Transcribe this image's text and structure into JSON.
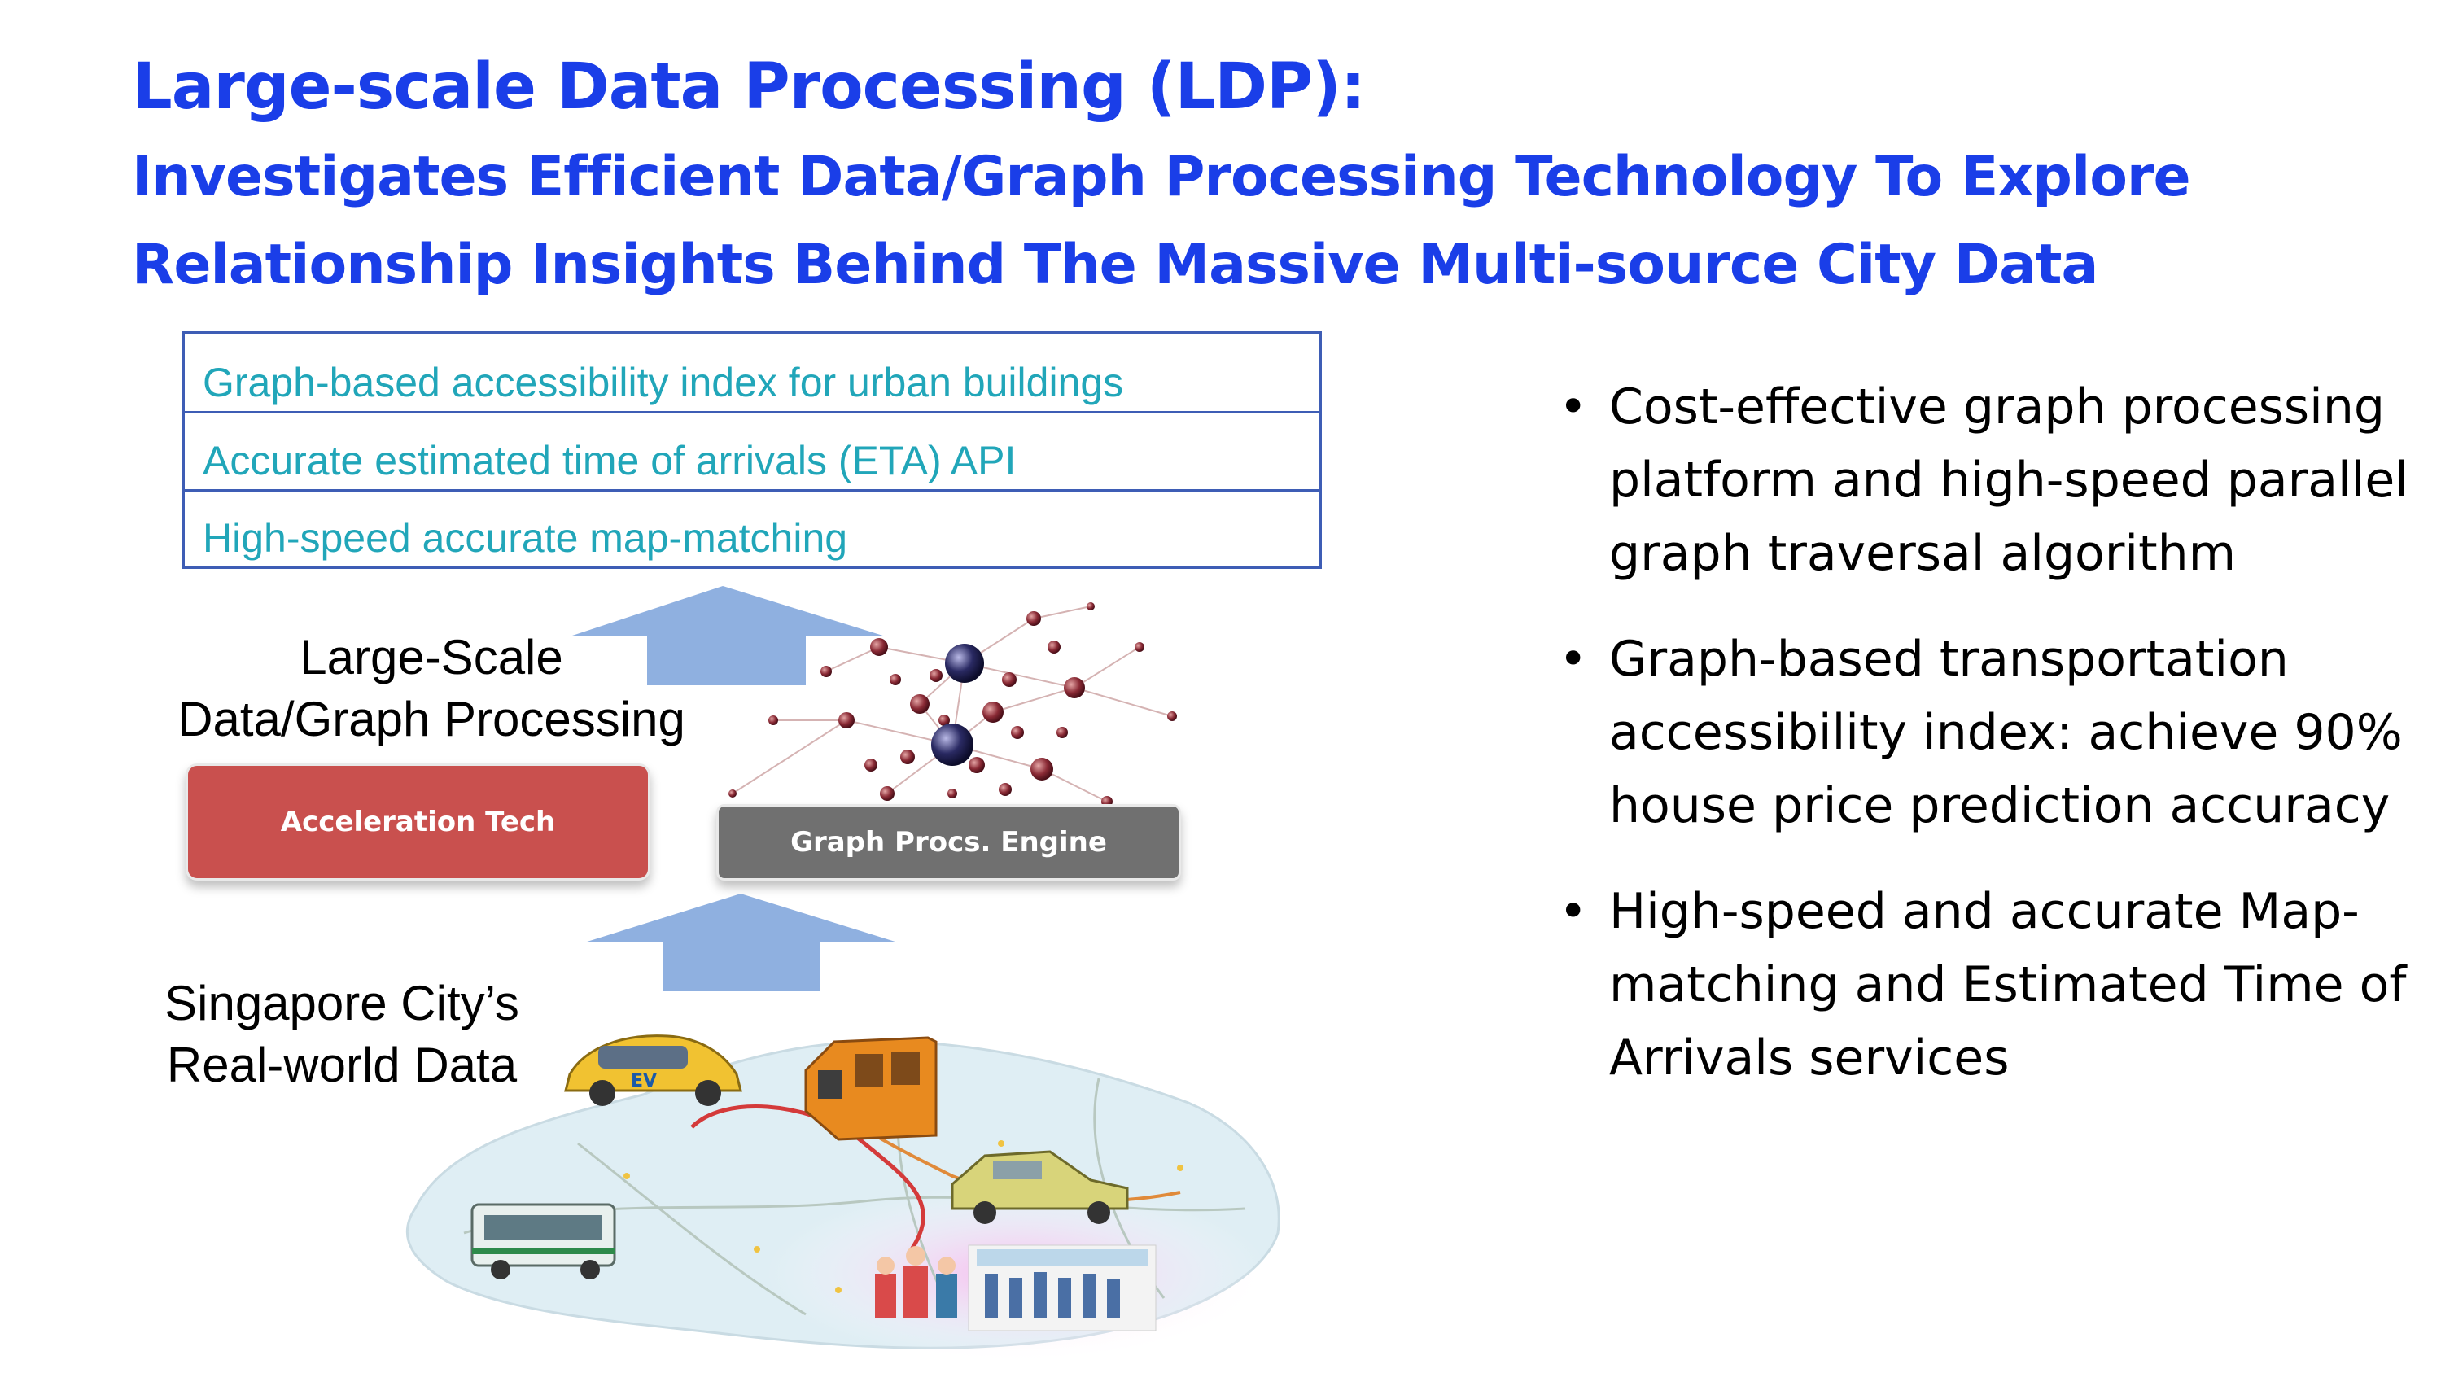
{
  "title": {
    "main": "Large-scale Data Processing (LDP):",
    "sub_line1": "Investigates Efficient Data/Graph Processing Technology To Explore",
    "sub_line2": "Relationship Insights Behind The Massive Multi-source City Data"
  },
  "applications": [
    "Graph-based accessibility index for urban buildings",
    "Accurate estimated time of arrivals (ETA) API",
    "High-speed accurate map-matching"
  ],
  "diagram": {
    "ldp_label_line1": "Large-Scale",
    "ldp_label_line2": "Data/Graph Processing",
    "acceleration_chip": "Acceleration Tech",
    "graph_engine_chip": "Graph Procs. Engine",
    "data_label_line1": "Singapore City’s",
    "data_label_line2": "Real-world Data",
    "car_badge": "EV"
  },
  "bullets": [
    "Cost-effective graph processing platform and high-speed parallel graph traversal algorithm",
    "Graph-based transportation accessibility index: achieve 90% house price prediction accuracy",
    "High-speed and accurate Map-matching and Estimated Time of Arrivals services"
  ],
  "colors": {
    "title_blue": "#1a3ee8",
    "app_text_teal": "#21a6b9",
    "box_border": "#3e5db5",
    "arrow_blue": "#8fb0e0",
    "accel_red": "#c9504e",
    "engine_gray": "#707070"
  }
}
